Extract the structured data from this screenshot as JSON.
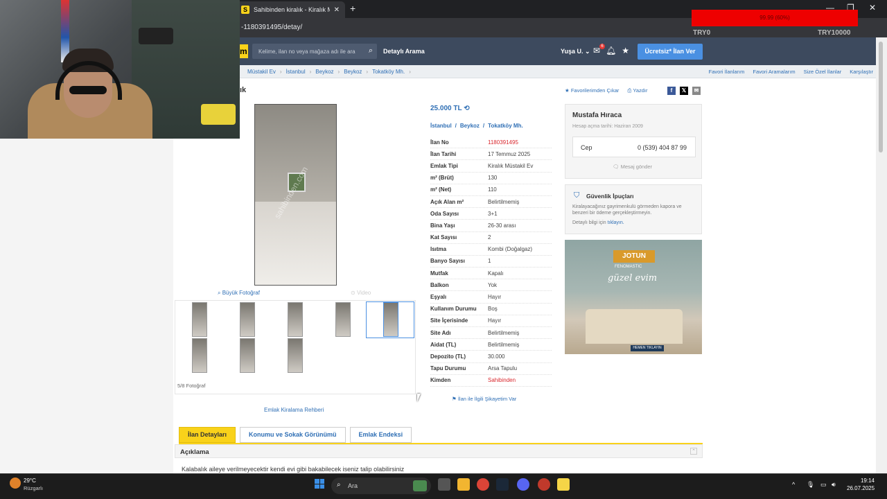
{
  "browser": {
    "tab_title": "Sahibinden kiralık - Kiralık Müs",
    "tab_favicon": "S",
    "url": "-1180391495/detay/",
    "donation_text": "99.99 (60%)",
    "try0": "TRY0",
    "try1": "TRY10000"
  },
  "site_header": {
    "logo": "m",
    "search_placeholder": "Kelime, ilan no veya mağaza adı ile ara",
    "detailed_search": "Detaylı Arama",
    "user": "Yuşa U.",
    "notif_count": "6",
    "post_ad": "Ücretsiz* İlan Ver"
  },
  "breadcrumb": {
    "items": [
      "Müstakil Ev",
      "İstanbul",
      "Beykoz",
      "Beykoz",
      "Tokatköy Mh."
    ],
    "links": [
      "Favori İlanlarım",
      "Favori Aramalarım",
      "Size Özel İlanlar",
      "Karşılaştır"
    ]
  },
  "listing": {
    "title_fragment": "ık",
    "fav_remove": "Favorilerimden Çıkar",
    "print": "Yazdır",
    "photo_watermark": "sahibinden.com",
    "big_photo": "Büyük Fotoğraf",
    "video": "Video",
    "photo_count": "5/8 Fotoğraf",
    "guide": "Emlak Kiralama Rehberi",
    "price": "25.000 TL",
    "location": [
      "İstanbul",
      "Beykoz",
      "Tokatköy Mh."
    ],
    "details": [
      {
        "key": "İlan No",
        "value": "1180391495"
      },
      {
        "key": "İlan Tarihi",
        "value": "17 Temmuz 2025"
      },
      {
        "key": "Emlak Tipi",
        "value": "Kiralık Müstakil Ev"
      },
      {
        "key": "m² (Brüt)",
        "value": "130"
      },
      {
        "key": "m² (Net)",
        "value": "110"
      },
      {
        "key": "Açık Alan m²",
        "value": "Belirtilmemiş"
      },
      {
        "key": "Oda Sayısı",
        "value": "3+1"
      },
      {
        "key": "Bina Yaşı",
        "value": "26-30 arası"
      },
      {
        "key": "Kat Sayısı",
        "value": "2"
      },
      {
        "key": "Isıtma",
        "value": "Kombi (Doğalgaz)"
      },
      {
        "key": "Banyo Sayısı",
        "value": "1"
      },
      {
        "key": "Mutfak",
        "value": "Kapalı"
      },
      {
        "key": "Balkon",
        "value": "Yok"
      },
      {
        "key": "Eşyalı",
        "value": "Hayır"
      },
      {
        "key": "Kullanım Durumu",
        "value": "Boş"
      },
      {
        "key": "Site İçerisinde",
        "value": "Hayır"
      },
      {
        "key": "Site Adı",
        "value": "Belirtilmemiş"
      },
      {
        "key": "Aidat (TL)",
        "value": "Belirtilmemiş"
      },
      {
        "key": "Depozito (TL)",
        "value": "30.000"
      },
      {
        "key": "Tapu Durumu",
        "value": "Arsa Tapulu"
      },
      {
        "key": "Kimden",
        "value": "Sahibinden"
      }
    ],
    "complaint": "İlan ile İlgili Şikayetim Var"
  },
  "seller": {
    "name": "Mustafa Hıraca",
    "joined": "Hesap açma tarihi: Haziran 2009",
    "phone_label": "Cep",
    "phone": "0 (539) 404 87 99",
    "message": "Mesaj gönder"
  },
  "security": {
    "title": "Güvenlik İpuçları",
    "text": "Kiralayacağınız gayrimenkulü görmeden kapora ve benzeri bir ödeme gerçekleştirmeyin.",
    "more": "Detaylı bilgi için",
    "more_link": "tıklayın."
  },
  "ad": {
    "brand": "JOTUN",
    "sub": "FENOMASTIC",
    "script": "güzel evim",
    "cta": "HEMEN TIKLAYIN"
  },
  "tabs": [
    "İlan Detayları",
    "Konumu ve Sokak Görünümü",
    "Emlak Endeksi"
  ],
  "description": {
    "title": "Açıklama",
    "text": "Kalabalık aileye verilmeyecektir kendi evi gibi bakabilecek iseniz talip olabilirsiniz"
  },
  "taskbar": {
    "temp": "29°C",
    "weather": "Rüzgarlı",
    "search": "Ara",
    "time": "19:14",
    "date": "26.07.2025"
  }
}
